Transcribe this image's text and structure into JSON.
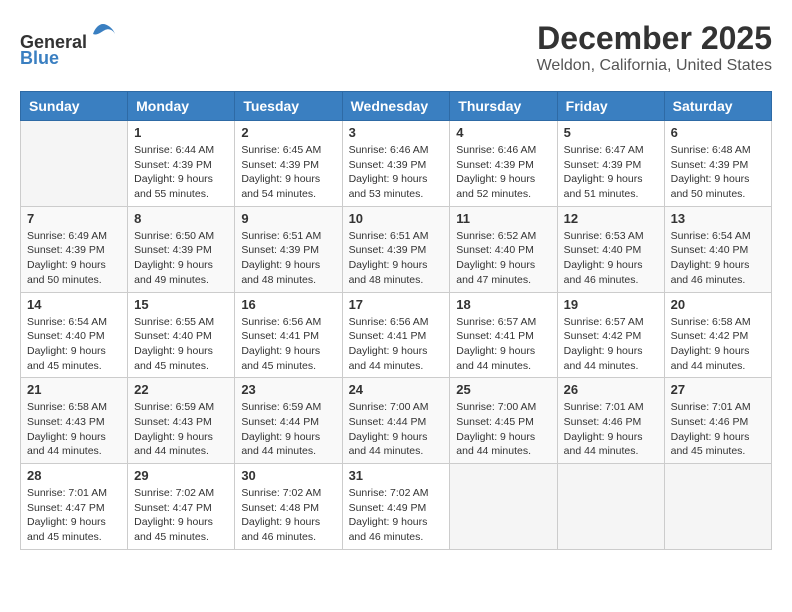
{
  "header": {
    "logo_line1": "General",
    "logo_line2": "Blue",
    "title": "December 2025",
    "subtitle": "Weldon, California, United States"
  },
  "calendar": {
    "days_of_week": [
      "Sunday",
      "Monday",
      "Tuesday",
      "Wednesday",
      "Thursday",
      "Friday",
      "Saturday"
    ],
    "weeks": [
      [
        {
          "day": "",
          "info": ""
        },
        {
          "day": "1",
          "info": "Sunrise: 6:44 AM\nSunset: 4:39 PM\nDaylight: 9 hours\nand 55 minutes."
        },
        {
          "day": "2",
          "info": "Sunrise: 6:45 AM\nSunset: 4:39 PM\nDaylight: 9 hours\nand 54 minutes."
        },
        {
          "day": "3",
          "info": "Sunrise: 6:46 AM\nSunset: 4:39 PM\nDaylight: 9 hours\nand 53 minutes."
        },
        {
          "day": "4",
          "info": "Sunrise: 6:46 AM\nSunset: 4:39 PM\nDaylight: 9 hours\nand 52 minutes."
        },
        {
          "day": "5",
          "info": "Sunrise: 6:47 AM\nSunset: 4:39 PM\nDaylight: 9 hours\nand 51 minutes."
        },
        {
          "day": "6",
          "info": "Sunrise: 6:48 AM\nSunset: 4:39 PM\nDaylight: 9 hours\nand 50 minutes."
        }
      ],
      [
        {
          "day": "7",
          "info": "Sunrise: 6:49 AM\nSunset: 4:39 PM\nDaylight: 9 hours\nand 50 minutes."
        },
        {
          "day": "8",
          "info": "Sunrise: 6:50 AM\nSunset: 4:39 PM\nDaylight: 9 hours\nand 49 minutes."
        },
        {
          "day": "9",
          "info": "Sunrise: 6:51 AM\nSunset: 4:39 PM\nDaylight: 9 hours\nand 48 minutes."
        },
        {
          "day": "10",
          "info": "Sunrise: 6:51 AM\nSunset: 4:39 PM\nDaylight: 9 hours\nand 48 minutes."
        },
        {
          "day": "11",
          "info": "Sunrise: 6:52 AM\nSunset: 4:40 PM\nDaylight: 9 hours\nand 47 minutes."
        },
        {
          "day": "12",
          "info": "Sunrise: 6:53 AM\nSunset: 4:40 PM\nDaylight: 9 hours\nand 46 minutes."
        },
        {
          "day": "13",
          "info": "Sunrise: 6:54 AM\nSunset: 4:40 PM\nDaylight: 9 hours\nand 46 minutes."
        }
      ],
      [
        {
          "day": "14",
          "info": "Sunrise: 6:54 AM\nSunset: 4:40 PM\nDaylight: 9 hours\nand 45 minutes."
        },
        {
          "day": "15",
          "info": "Sunrise: 6:55 AM\nSunset: 4:40 PM\nDaylight: 9 hours\nand 45 minutes."
        },
        {
          "day": "16",
          "info": "Sunrise: 6:56 AM\nSunset: 4:41 PM\nDaylight: 9 hours\nand 45 minutes."
        },
        {
          "day": "17",
          "info": "Sunrise: 6:56 AM\nSunset: 4:41 PM\nDaylight: 9 hours\nand 44 minutes."
        },
        {
          "day": "18",
          "info": "Sunrise: 6:57 AM\nSunset: 4:41 PM\nDaylight: 9 hours\nand 44 minutes."
        },
        {
          "day": "19",
          "info": "Sunrise: 6:57 AM\nSunset: 4:42 PM\nDaylight: 9 hours\nand 44 minutes."
        },
        {
          "day": "20",
          "info": "Sunrise: 6:58 AM\nSunset: 4:42 PM\nDaylight: 9 hours\nand 44 minutes."
        }
      ],
      [
        {
          "day": "21",
          "info": "Sunrise: 6:58 AM\nSunset: 4:43 PM\nDaylight: 9 hours\nand 44 minutes."
        },
        {
          "day": "22",
          "info": "Sunrise: 6:59 AM\nSunset: 4:43 PM\nDaylight: 9 hours\nand 44 minutes."
        },
        {
          "day": "23",
          "info": "Sunrise: 6:59 AM\nSunset: 4:44 PM\nDaylight: 9 hours\nand 44 minutes."
        },
        {
          "day": "24",
          "info": "Sunrise: 7:00 AM\nSunset: 4:44 PM\nDaylight: 9 hours\nand 44 minutes."
        },
        {
          "day": "25",
          "info": "Sunrise: 7:00 AM\nSunset: 4:45 PM\nDaylight: 9 hours\nand 44 minutes."
        },
        {
          "day": "26",
          "info": "Sunrise: 7:01 AM\nSunset: 4:46 PM\nDaylight: 9 hours\nand 44 minutes."
        },
        {
          "day": "27",
          "info": "Sunrise: 7:01 AM\nSunset: 4:46 PM\nDaylight: 9 hours\nand 45 minutes."
        }
      ],
      [
        {
          "day": "28",
          "info": "Sunrise: 7:01 AM\nSunset: 4:47 PM\nDaylight: 9 hours\nand 45 minutes."
        },
        {
          "day": "29",
          "info": "Sunrise: 7:02 AM\nSunset: 4:47 PM\nDaylight: 9 hours\nand 45 minutes."
        },
        {
          "day": "30",
          "info": "Sunrise: 7:02 AM\nSunset: 4:48 PM\nDaylight: 9 hours\nand 46 minutes."
        },
        {
          "day": "31",
          "info": "Sunrise: 7:02 AM\nSunset: 4:49 PM\nDaylight: 9 hours\nand 46 minutes."
        },
        {
          "day": "",
          "info": ""
        },
        {
          "day": "",
          "info": ""
        },
        {
          "day": "",
          "info": ""
        }
      ]
    ]
  }
}
